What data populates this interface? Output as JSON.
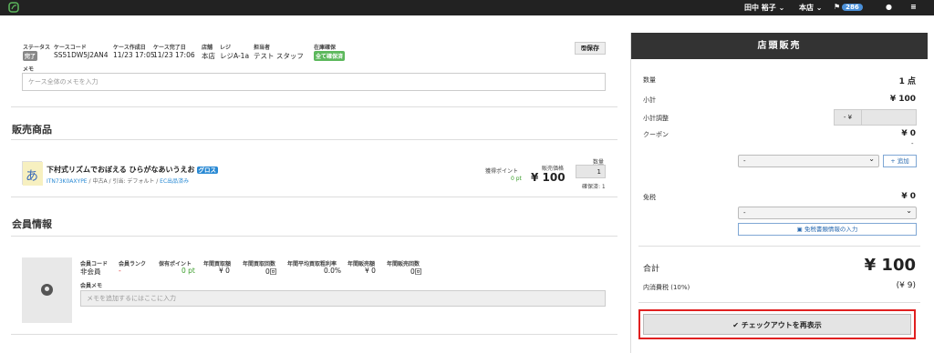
{
  "topbar": {
    "user": "田中 裕子 ⌄",
    "store": "本店 ⌄",
    "notif_count": "286"
  },
  "case": {
    "labels": {
      "status": "ステータス",
      "case_code": "ケースコード",
      "created": "ケース作成日",
      "completed": "ケース完了日",
      "store": "店舗",
      "register": "レジ",
      "staff": "担当者",
      "stock": "在庫確保",
      "memo": "メモ"
    },
    "status": "完了",
    "case_code": "SS51DW5J2AN4",
    "created": "11/23 17:05",
    "completed": "11/23 17:06",
    "store": "本店",
    "register": "レジA-1a",
    "staff": "テスト スタッフ",
    "stock": "全て確保済",
    "save_label": "保存",
    "memo_placeholder": "ケース全体のメモを入力"
  },
  "sales": {
    "title": "販売商品",
    "product_name": "下村式リズムでおぼえる ひらがなあいうえお",
    "product_tag": "グロス",
    "product_code": "ITN73K0AXYPE",
    "product_cond": " / 中古A / 引当: デフォルト / ",
    "product_ec": "EC出品済み",
    "points_label": "獲得ポイント",
    "points_value": "0 pt",
    "price_label": "販売価格",
    "price": "¥ 100",
    "qty_label": "数量",
    "qty": "1",
    "reserved": "確保済: 1"
  },
  "member": {
    "title": "会員情報",
    "labels": [
      "会員コード",
      "会員ランク",
      "保有ポイント",
      "年間買取額",
      "年間買取回数",
      "年間平均買取粗利率",
      "年間販売額",
      "年間販売回数"
    ],
    "values": [
      "非会員",
      "-",
      "0 pt",
      "¥ 0",
      "0回",
      "0.0%",
      "¥ 0",
      "0回"
    ],
    "memo_label": "会員メモ",
    "memo_placeholder": "メモを追加するにはここに入力"
  },
  "register": {
    "title": "店頭販売",
    "qty_label": "数量",
    "qty_value": "1 点",
    "subtotal_label": "小計",
    "subtotal_value": "¥ 100",
    "adjust_label": "小計調整",
    "adjust_prefix": "- ¥",
    "coupon_label": "クーポン",
    "coupon_value": "¥ 0",
    "coupon_dash": "-",
    "coupon_select": "-",
    "add_label": "+ 追加",
    "taxfree_label": "免税",
    "taxfree_value": "¥ 0",
    "taxfree_select": "-",
    "taxfree_btn": "免税書類情報の入力",
    "total_label": "合計",
    "total_value": "¥ 100",
    "tax_label": "内消費税 (10%)",
    "tax_value": "(¥ 9)",
    "checkout_label": "✔ チェックアウトを再表示"
  }
}
